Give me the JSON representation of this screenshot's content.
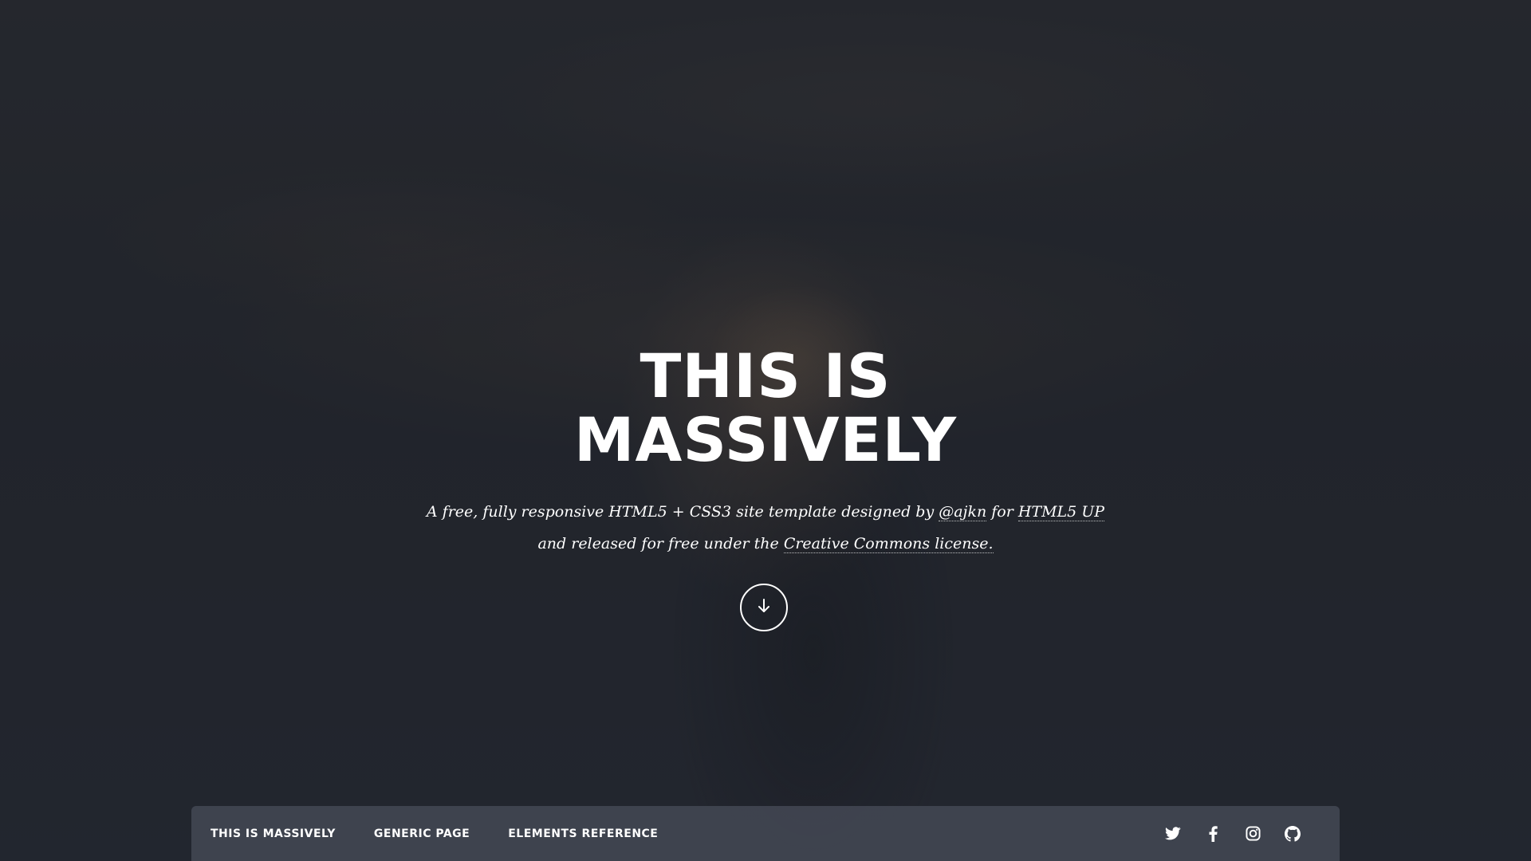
{
  "hero": {
    "title_line1": "THIS IS",
    "title_line2": "MASSIVELY",
    "subtitle": {
      "part1": "A free, fully responsive HTML5 + CSS3 site template designed by ",
      "link_author": "@ajkn",
      "part2": " for ",
      "link_html5up": "HTML5 UP",
      "part3": "and released for free under the ",
      "link_license": "Creative Commons license."
    },
    "scroll_icon": "arrow-down-icon"
  },
  "nav": {
    "links": [
      {
        "label": "THIS IS MASSIVELY"
      },
      {
        "label": "GENERIC PAGE"
      },
      {
        "label": "ELEMENTS REFERENCE"
      }
    ],
    "icons": [
      "twitter-icon",
      "facebook-icon",
      "instagram-icon",
      "github-icon"
    ]
  },
  "colors": {
    "text": "#ffffff",
    "background": "#22252c",
    "navbar": "#484e5a"
  }
}
